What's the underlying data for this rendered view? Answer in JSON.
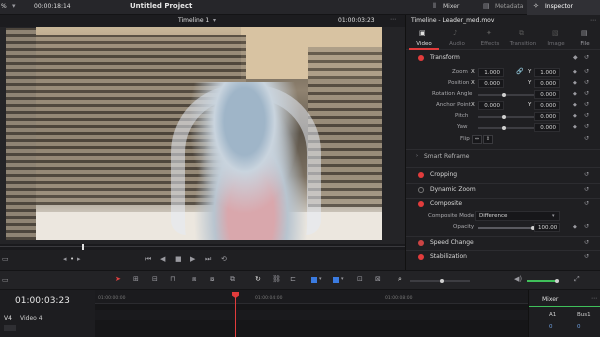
{
  "topbar": {
    "zoom": "%",
    "timecode_left": "00:00:18:14",
    "title": "Untitled Project",
    "mixer": "Mixer",
    "metadata": "Metadata",
    "inspector": "Inspector"
  },
  "viewer": {
    "timeline_name": "Timeline 1",
    "timecode": "01:00:03:23"
  },
  "inspector": {
    "clip_name": "Timeline - Leader_med.mov",
    "tabs": [
      "Video",
      "Audio",
      "Effects",
      "Transition",
      "Image",
      "File"
    ],
    "transform": {
      "label": "Transform",
      "zoom_label": "Zoom",
      "zoom_x": "1.000",
      "zoom_y": "1.000",
      "position_label": "Position",
      "position_x": "0.000",
      "position_y": "0.000",
      "rotation_label": "Rotation Angle",
      "rotation": "0.000",
      "anchor_label": "Anchor Point",
      "anchor_x": "0.000",
      "anchor_y": "0.000",
      "pitch_label": "Pitch",
      "pitch": "0.000",
      "yaw_label": "Yaw",
      "yaw": "0.000",
      "flip_label": "Flip",
      "x_label": "X",
      "y_label": "Y"
    },
    "smart_reframe": "Smart Reframe",
    "cropping": "Cropping",
    "dynamic_zoom": "Dynamic Zoom",
    "composite": {
      "label": "Composite",
      "mode_label": "Composite Mode",
      "mode_value": "Difference",
      "opacity_label": "Opacity",
      "opacity_value": "100.00"
    },
    "speed_change": "Speed Change",
    "stabilization": "Stabilization"
  },
  "timeline": {
    "timecode": "01:00:03:23",
    "track_id": "V4",
    "track_name": "Video 4",
    "ruler": [
      "01:00:00:00",
      "01:00:04:00",
      "01:00:08:00"
    ]
  },
  "mixer": {
    "title": "Mixer",
    "a1": "A1",
    "bus1": "Bus1",
    "meter_label": "0"
  },
  "colors": {
    "accent": "#e23c3c",
    "playhead": "#e23c3c",
    "blue": "#3b7be0",
    "green": "#3fbf5a"
  }
}
